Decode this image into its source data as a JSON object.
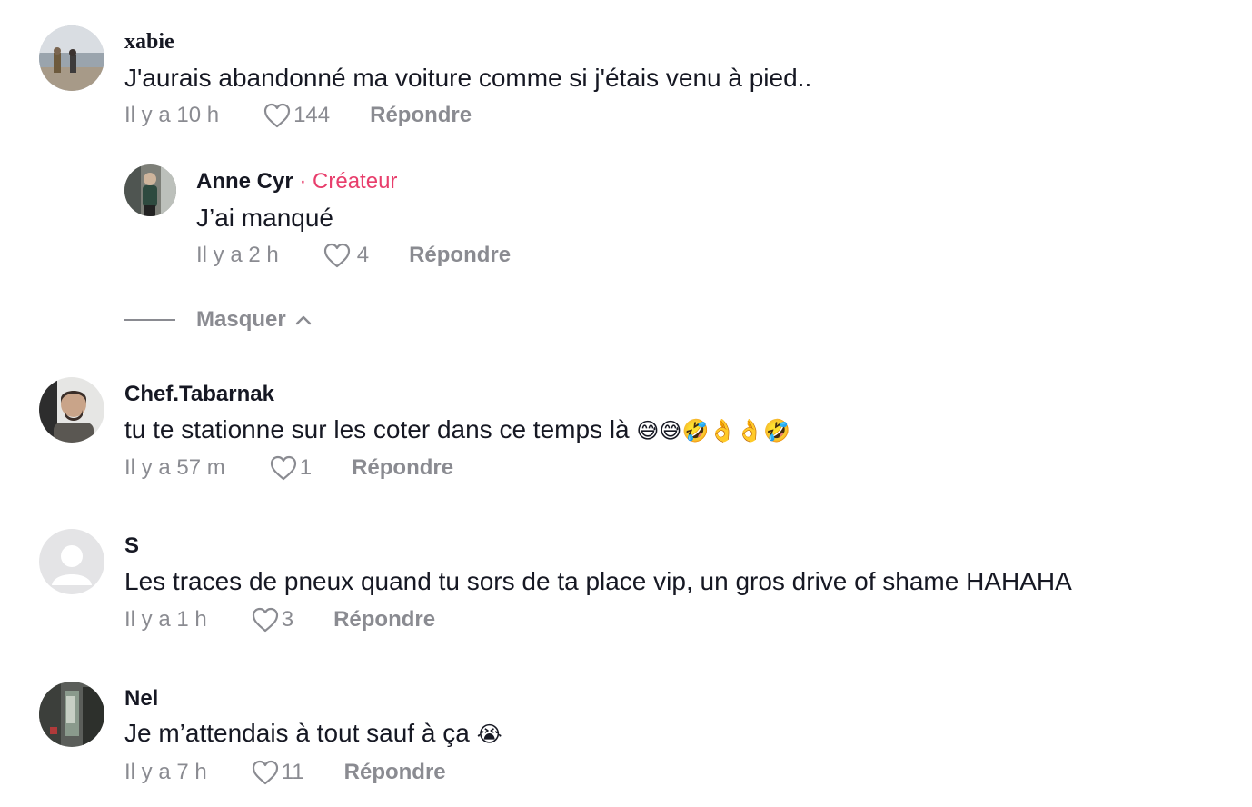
{
  "comments": [
    {
      "username": "xabie",
      "text": "J'aurais abandonné ma voiture comme si j'étais venu à pied..",
      "time": "Il y a 10 h",
      "likes": "144",
      "reply_label": "Répondre"
    },
    {
      "username": "Anne Cyr",
      "separator": "·",
      "badge": "Créateur",
      "text": "J’ai manqué",
      "time": "Il y a 2 h",
      "likes": "4",
      "reply_label": "Répondre"
    },
    {
      "username": "Chef.Tabarnak",
      "text": "tu te stationne sur les coter dans ce temps là",
      "emojis": "😅😅🤣👌👌🤣",
      "time": "Il y a 57 m",
      "likes": "1",
      "reply_label": "Répondre"
    },
    {
      "username": "S",
      "text": "Les traces de pneux quand tu sors de ta place vip, un gros drive of shame HAHAHA",
      "time": "Il y a 1 h",
      "likes": "3",
      "reply_label": "Répondre"
    },
    {
      "username": "Nel",
      "text": "Je m’attendais à tout sauf à ça",
      "emojis": "😭",
      "time": "Il y a 7 h",
      "likes": "11",
      "reply_label": "Répondre"
    }
  ],
  "hide_replies_label": "Masquer",
  "colors": {
    "text": "#161823",
    "muted": "#8a8b91",
    "creator_badge": "#e83e6c"
  },
  "icons": {
    "like": "heart-outline-icon",
    "collapse": "chevron-up-icon"
  }
}
